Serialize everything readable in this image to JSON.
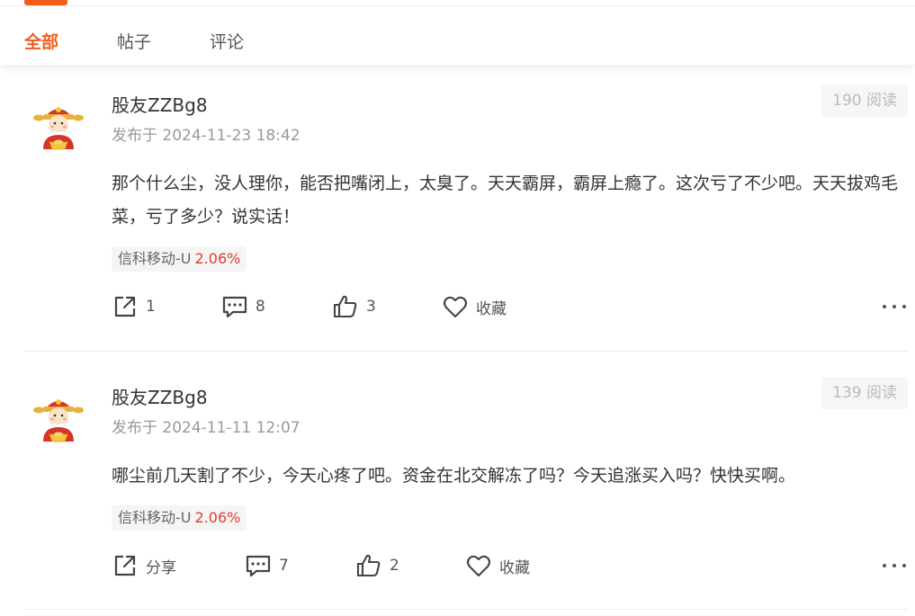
{
  "tabs": [
    {
      "label": "全部",
      "active": true
    },
    {
      "label": "帖子",
      "active": false
    },
    {
      "label": "评论",
      "active": false
    }
  ],
  "colors": {
    "accent": "#f25c19",
    "rise": "#e33b2e"
  },
  "posts": [
    {
      "author": "股友ZZBg8",
      "time": "发布于 2024-11-23 18:42",
      "views": "190 阅读",
      "content": "那个什么尘，没人理你，能否把嘴闭上，太臭了。天天霸屏，霸屏上瘾了。这次亏了不少吧。天天拔鸡毛菜，亏了多少？说实话！",
      "stock": {
        "name": "信科移动-U",
        "change": "2.06%"
      },
      "actions": {
        "share": "1",
        "comment": "8",
        "like": "3",
        "favorite": "收藏"
      },
      "icons": [
        "avatar-icon",
        "share-icon",
        "comment-icon",
        "like-icon",
        "heart-icon",
        "more-icon"
      ]
    },
    {
      "author": "股友ZZBg8",
      "time": "发布于 2024-11-11 12:07",
      "views": "139 阅读",
      "content": "哪尘前几天割了不少，今天心疼了吧。资金在北交解冻了吗？今天追涨买入吗？快快买啊。",
      "stock": {
        "name": "信科移动-U",
        "change": "2.06%"
      },
      "actions": {
        "share": "分享",
        "comment": "7",
        "like": "2",
        "favorite": "收藏"
      },
      "icons": [
        "avatar-icon",
        "share-icon",
        "comment-icon",
        "like-icon",
        "heart-icon",
        "more-icon"
      ]
    }
  ]
}
